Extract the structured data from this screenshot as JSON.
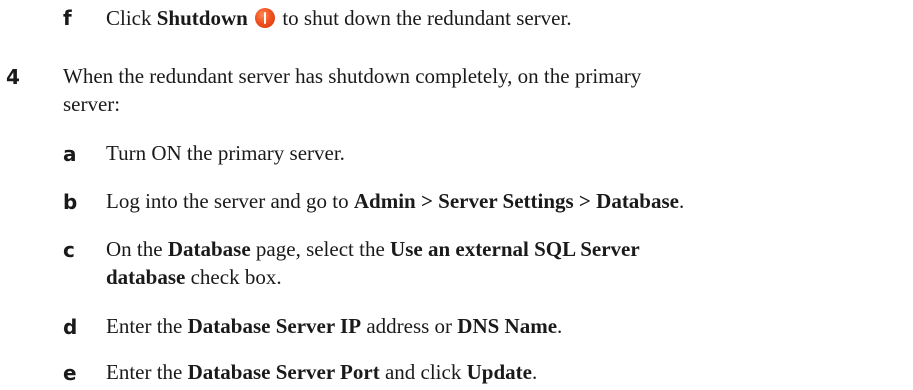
{
  "step_f_top": {
    "marker": "f",
    "pre": "Click ",
    "bold": "Shutdown",
    "post": " to shut down the redundant server.",
    "icon": "shutdown-power-icon"
  },
  "step_4": {
    "marker": "4",
    "line1": "When the redundant server has shutdown completely, on the primary",
    "line2": "server:"
  },
  "substeps": {
    "a": {
      "marker": "a",
      "text": "Turn ON the primary server."
    },
    "b": {
      "marker": "b",
      "pre": "Log into the server and go to ",
      "bold": "Admin > Server Settings > Database",
      "post": "."
    },
    "c": {
      "marker": "c",
      "pre": "On the ",
      "bold1": "Database",
      "mid": " page, select the ",
      "bold2": "Use an external SQL Server",
      "bold3": "database",
      "post": " check box."
    },
    "d": {
      "marker": "d",
      "pre": "Enter the ",
      "bold1": "Database Server IP",
      "mid": " address or ",
      "bold2": "DNS Name",
      "post": "."
    },
    "e": {
      "marker": "e",
      "pre": "Enter the ",
      "bold1": "Database Server Port",
      "mid": " and click ",
      "bold2": "Update",
      "post": "."
    }
  }
}
